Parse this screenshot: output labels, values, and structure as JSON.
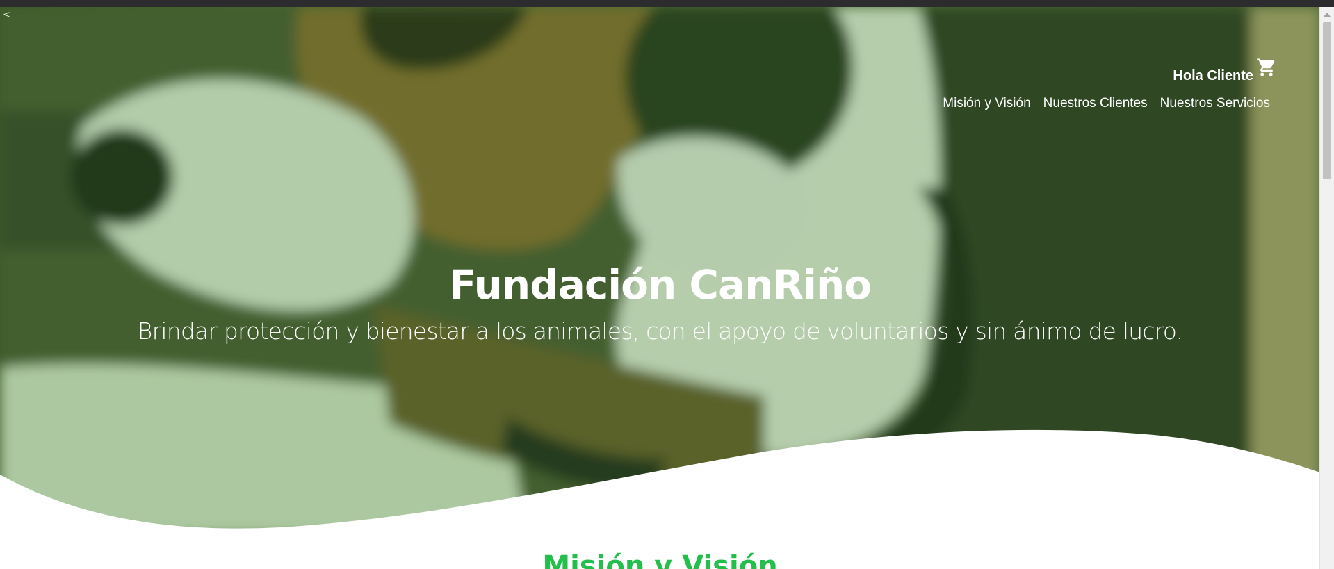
{
  "header": {
    "greeting": "Hola Cliente",
    "cart_icon": "shopping-cart-icon",
    "nav": [
      {
        "label": "Misión y Visión"
      },
      {
        "label": "Nuestros Clientes"
      },
      {
        "label": "Nuestros Servicios"
      }
    ]
  },
  "hero": {
    "back_glyph": "<",
    "title": "Fundación CanRiño",
    "subtitle": "Brindar protección y bienestar a los animales, con el apoyo de voluntarios y sin ánimo de lucro."
  },
  "sections": [
    {
      "heading": "Misión y Visión"
    }
  ],
  "colors": {
    "overlay": "#347828",
    "heading_green": "#22c04a",
    "text_white": "#ffffff"
  }
}
